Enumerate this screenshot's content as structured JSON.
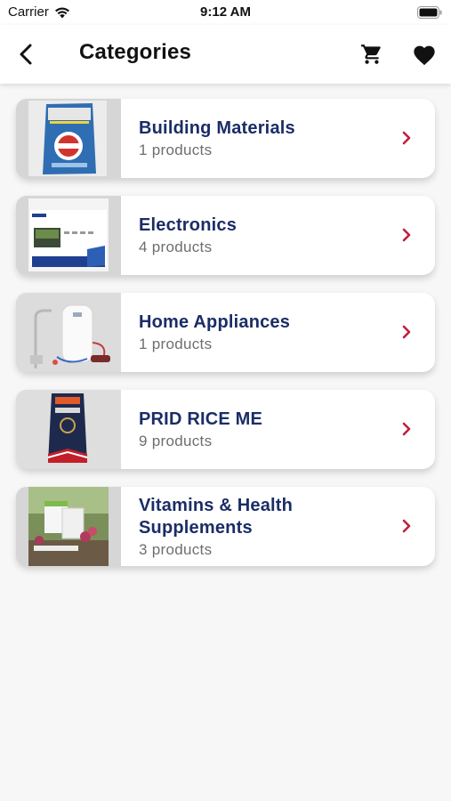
{
  "status_bar": {
    "carrier": "Carrier",
    "time": "9:12 AM"
  },
  "nav": {
    "title": "Categories",
    "back_icon": "back-arrow-icon",
    "cart_icon": "cart-icon",
    "favorites_icon": "heart-icon"
  },
  "colors": {
    "category_name": "#1b2d66",
    "chevron": "#c21f3a",
    "product_count": "#6e6e6e"
  },
  "categories": [
    {
      "name": "Building Materials",
      "count": "1 products"
    },
    {
      "name": "Electronics",
      "count": "4 products"
    },
    {
      "name": "Home Appliances",
      "count": "1 products"
    },
    {
      "name": "PRID RICE ME",
      "count": "9 products"
    },
    {
      "name": "Vitamins & Health Supplements",
      "count": "3 products"
    }
  ]
}
